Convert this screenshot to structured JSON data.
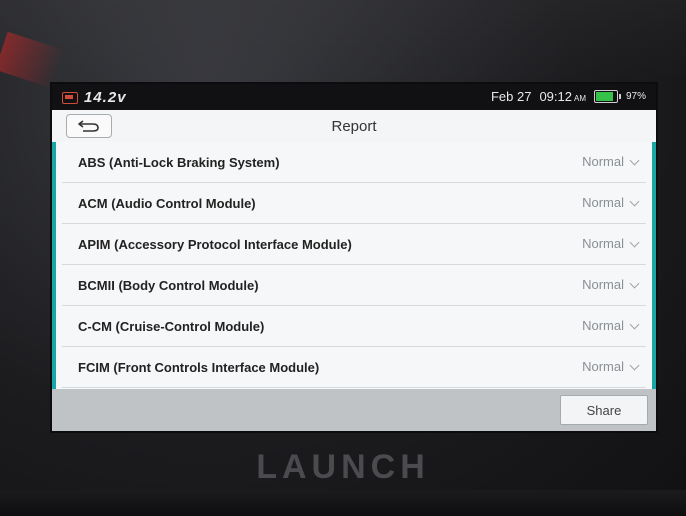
{
  "status_bar": {
    "voltage": "14.2v",
    "date": "Feb 27",
    "time": "09:12",
    "ampm": "AM",
    "battery_percent": "97%",
    "battery_level": 0.97,
    "icons": [
      "vehicle-voltage-icon",
      "battery-icon"
    ],
    "battery_color": "#36c24a"
  },
  "header": {
    "title": "Report",
    "back_icon": "back-arrow-icon"
  },
  "modules": [
    {
      "name": "ABS (Anti-Lock Braking System)",
      "status": "Normal"
    },
    {
      "name": "ACM (Audio Control Module)",
      "status": "Normal"
    },
    {
      "name": "APIM (Accessory Protocol Interface Module)",
      "status": "Normal"
    },
    {
      "name": "BCMII (Body Control Module)",
      "status": "Normal"
    },
    {
      "name": "C-CM (Cruise-Control Module)",
      "status": "Normal"
    },
    {
      "name": "FCIM (Front Controls Interface Module)",
      "status": "Normal"
    }
  ],
  "footer": {
    "share_label": "Share"
  },
  "device": {
    "brand": "LAUNCH"
  },
  "colors": {
    "accent": "#1aa6a6"
  }
}
